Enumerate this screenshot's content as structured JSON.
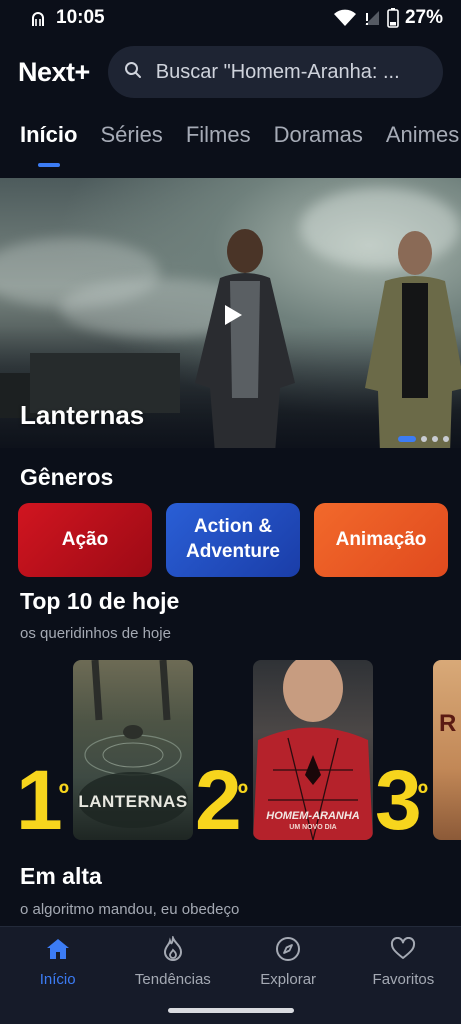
{
  "status_bar": {
    "time": "10:05",
    "battery": "27%"
  },
  "header": {
    "logo": "Next+",
    "search_placeholder": "Buscar \"Homem-Aranha: ..."
  },
  "tabs": [
    {
      "label": "Início",
      "active": true
    },
    {
      "label": "Séries"
    },
    {
      "label": "Filmes"
    },
    {
      "label": "Doramas"
    },
    {
      "label": "Animes"
    }
  ],
  "hero": {
    "title": "Lanternas",
    "slide_count": 4,
    "active_slide": 1
  },
  "genres": {
    "title": "Gêneros",
    "items": [
      {
        "label": "Ação",
        "color": "#c3111c"
      },
      {
        "label": "Action & Adventure",
        "color": "#2450c2"
      },
      {
        "label": "Animação",
        "color": "#ec5a25"
      }
    ]
  },
  "top10": {
    "title": "Top 10 de hoje",
    "subtitle": "os queridinhos de hoje",
    "items": [
      {
        "rank": "1",
        "ordinal": "º",
        "poster_title": "LANTERNAS"
      },
      {
        "rank": "2",
        "ordinal": "º",
        "poster_title": "HOMEM-ARANHA",
        "poster_subtitle": "UM NOVO DIA"
      },
      {
        "rank": "3",
        "ordinal": "º",
        "poster_title": "R"
      }
    ]
  },
  "trending": {
    "title": "Em alta",
    "subtitle": "o algoritmo mandou, eu obedeço"
  },
  "bottom_nav": [
    {
      "label": "Início",
      "icon": "home-icon",
      "active": true
    },
    {
      "label": "Tendências",
      "icon": "flame-icon"
    },
    {
      "label": "Explorar",
      "icon": "compass-icon"
    },
    {
      "label": "Favoritos",
      "icon": "heart-icon"
    }
  ],
  "colors": {
    "accent": "#3c7cf4",
    "rank": "#f7d51d",
    "background": "#0b0f19"
  }
}
